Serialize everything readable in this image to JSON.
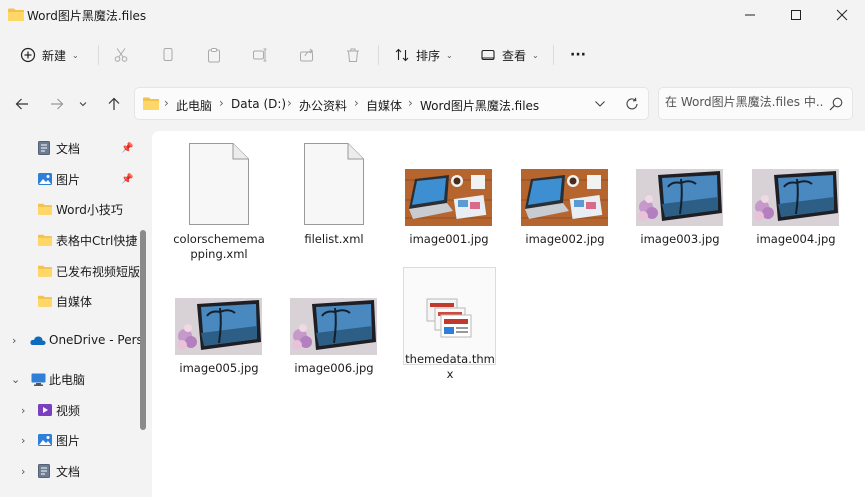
{
  "window": {
    "title": "Word图片黑魔法.files"
  },
  "toolbar": {
    "new_label": "新建",
    "sort_label": "排序",
    "view_label": "查看",
    "more_label": "···"
  },
  "address": {
    "crumbs": [
      "此电脑",
      "Data (D:)",
      "办公资料",
      "自媒体",
      "Word图片黑魔法.files"
    ],
    "separator": "›"
  },
  "search": {
    "placeholder": "在 Word图片黑魔法.files 中..."
  },
  "sidebar": {
    "items": [
      {
        "label": "文档"
      },
      {
        "label": "图片"
      },
      {
        "label": "Word小技巧"
      },
      {
        "label": "表格中Ctrl快捷"
      },
      {
        "label": "已发布视频短版"
      },
      {
        "label": "自媒体"
      },
      {
        "label": "OneDrive - Pers"
      },
      {
        "label": "此电脑"
      },
      {
        "label": "视频"
      },
      {
        "label": "图片"
      },
      {
        "label": "文档"
      }
    ]
  },
  "files": [
    {
      "name": "colorschememapping.xml",
      "type": "xml"
    },
    {
      "name": "filelist.xml",
      "type": "xml"
    },
    {
      "name": "image001.jpg",
      "type": "jpg-laptop"
    },
    {
      "name": "image002.jpg",
      "type": "jpg-laptop"
    },
    {
      "name": "image003.jpg",
      "type": "jpg-tablet"
    },
    {
      "name": "image004.jpg",
      "type": "jpg-tablet"
    },
    {
      "name": "image005.jpg",
      "type": "jpg-tablet"
    },
    {
      "name": "image006.jpg",
      "type": "jpg-tablet"
    },
    {
      "name": "themedata.thmx",
      "type": "thmx"
    }
  ],
  "colors": {
    "folder": "#f2c14e",
    "accent": "#0067c0",
    "wood": "#b5652d"
  }
}
